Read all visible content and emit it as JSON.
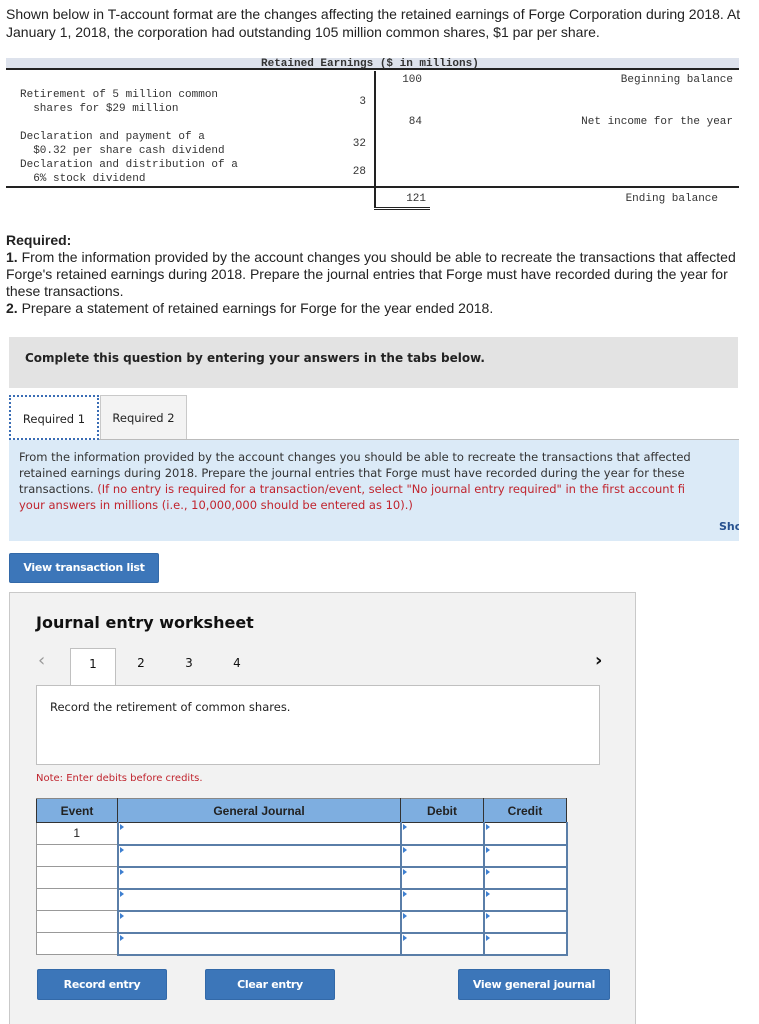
{
  "intro": "Shown below in T-account format are the changes affecting the retained earnings of Forge Corporation during 2018. At January 1, 2018, the corporation had outstanding 105 million common shares, $1 par per share.",
  "t_account": {
    "title": "Retained Earnings ($ in millions)",
    "debits": [
      {
        "label": "Retirement of 5 million common\n  shares for $29 million",
        "amount": "3"
      },
      {
        "label": "Declaration and payment of a\n  $0.32 per share cash dividend",
        "amount": "32"
      },
      {
        "label": "Declaration and distribution of a\n  6% stock dividend",
        "amount": "28"
      }
    ],
    "credits": [
      {
        "label": "Beginning balance",
        "amount": "100"
      },
      {
        "label": "Net income for the year",
        "amount": "84"
      }
    ],
    "ending": {
      "label": "Ending balance",
      "amount": "121"
    }
  },
  "required": {
    "heading": "Required:",
    "item1_num": "1.",
    "item1": " From the information provided by the account changes you should be able to recreate the transactions that affected Forge's retained earnings during 2018. Prepare the journal entries that Forge must have recorded during the year for these transactions.",
    "item2_num": "2.",
    "item2": " Prepare a statement of retained earnings for Forge for the year ended 2018."
  },
  "complete_bar": "Complete this question by entering your answers in the tabs below.",
  "tabs": [
    {
      "label": "Required 1",
      "active": true
    },
    {
      "label": "Required 2",
      "active": false
    }
  ],
  "instructions": {
    "line1": "From the information provided by the account changes you should be able to recreate the transactions that affected",
    "line2": "retained earnings during 2018. Prepare the journal entries that Forge must have recorded during the year for these",
    "line3_black": "transactions. ",
    "line3_red": "(If no entry is required for a transaction/event, select \"No journal entry required\" in the first account fi",
    "line4_red": "your answers in millions (i.e., 10,000,000 should be entered as 10).)",
    "show_link": "Sho"
  },
  "buttons": {
    "view_transaction_list": "View transaction list",
    "record_entry": "Record entry",
    "clear_entry": "Clear entry",
    "view_general_journal": "View general journal"
  },
  "worksheet": {
    "title": "Journal entry worksheet",
    "prev_icon": "‹",
    "next_icon": "›",
    "steps": [
      "1",
      "2",
      "3",
      "4"
    ],
    "active_step": "1",
    "description": "Record the retirement of common shares.",
    "note": "Note: Enter debits before credits.",
    "columns": [
      "Event",
      "General Journal",
      "Debit",
      "Credit"
    ],
    "rows": [
      {
        "event": "1",
        "account": "",
        "debit": "",
        "credit": ""
      },
      {
        "event": "",
        "account": "",
        "debit": "",
        "credit": ""
      },
      {
        "event": "",
        "account": "",
        "debit": "",
        "credit": ""
      },
      {
        "event": "",
        "account": "",
        "debit": "",
        "credit": ""
      },
      {
        "event": "",
        "account": "",
        "debit": "",
        "credit": ""
      },
      {
        "event": "",
        "account": "",
        "debit": "",
        "credit": ""
      }
    ]
  },
  "colors": {
    "button_blue": "#3c76b9",
    "table_header_blue": "#7eaee0",
    "instructions_bg": "#dbeaf7",
    "note_red": "#c0242e"
  }
}
